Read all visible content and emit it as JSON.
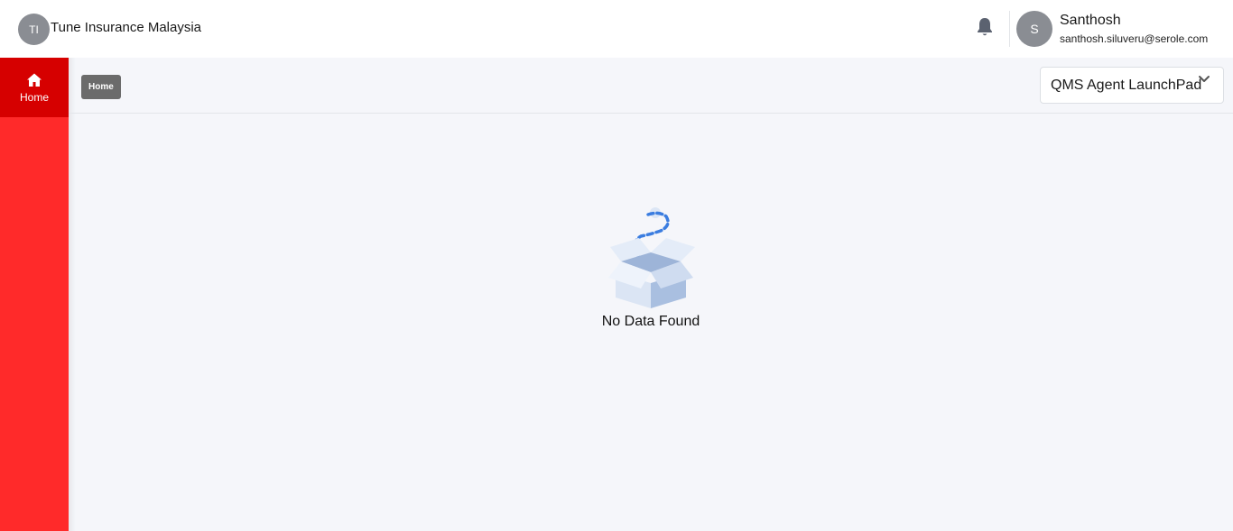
{
  "header": {
    "org_initials": "TI",
    "org_name": "Tune Insurance Malaysia",
    "notification_icon": "bell-icon",
    "user_initial": "S",
    "user_name": "Santhosh",
    "user_email": "santhosh.siluveru@serole.com"
  },
  "sidebar": {
    "items": [
      {
        "label": "Home",
        "icon": "home-icon",
        "active": true
      }
    ],
    "colors": {
      "background": "#ff2a2a",
      "active": "#d60000"
    }
  },
  "breadcrumb": {
    "current": "Home"
  },
  "app_selector": {
    "selected": "QMS Agent LaunchPad",
    "icon": "chevron-down-icon"
  },
  "empty_state": {
    "message": "No Data Found",
    "icon": "empty-box-icon"
  }
}
